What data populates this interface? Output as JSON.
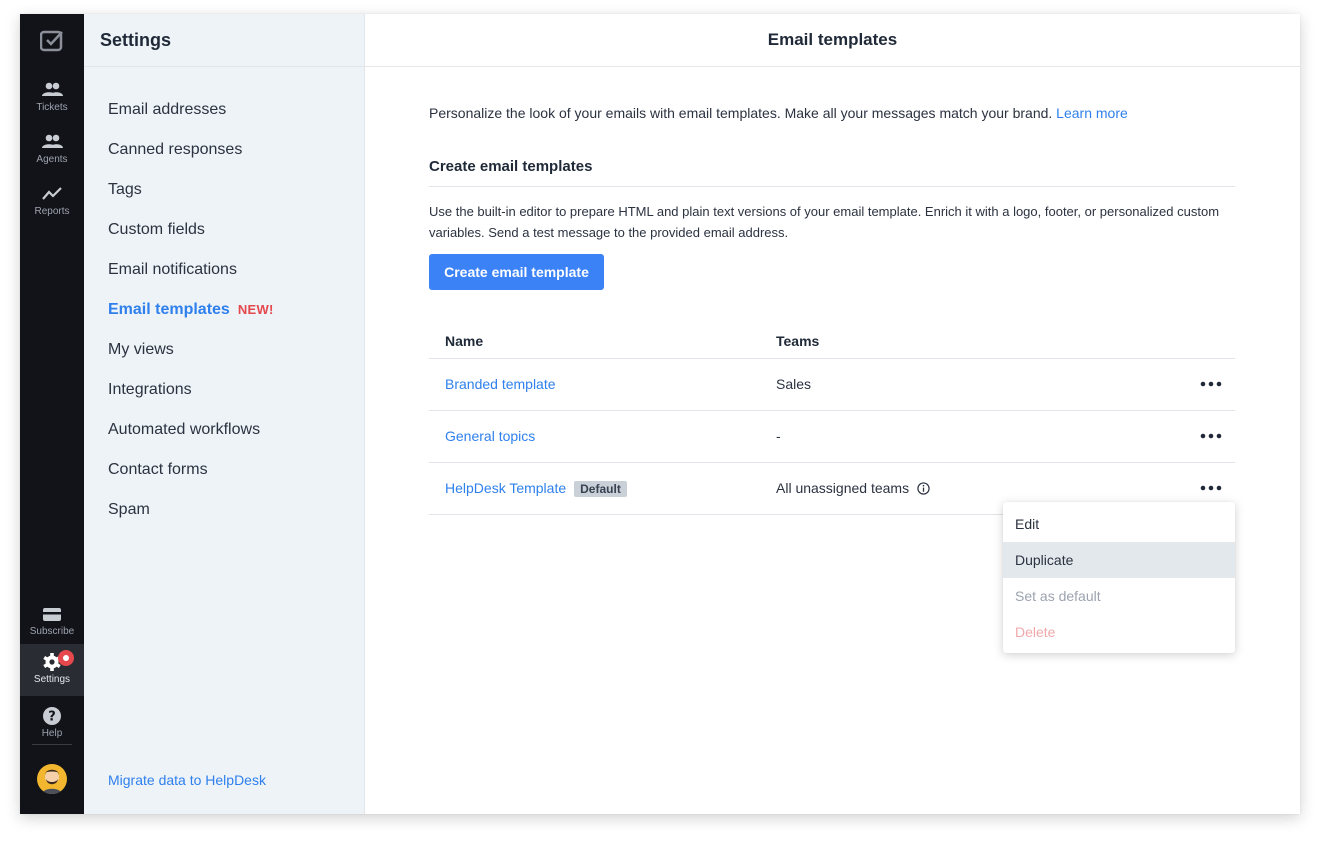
{
  "rail": {
    "items": [
      {
        "label": "Tickets",
        "icon": "people-icon"
      },
      {
        "label": "Agents",
        "icon": "people-icon"
      },
      {
        "label": "Reports",
        "icon": "chart-line-icon"
      }
    ],
    "bottom": [
      {
        "label": "Subscribe",
        "icon": "card-icon"
      },
      {
        "label": "Settings",
        "icon": "gear-icon"
      },
      {
        "label": "Help",
        "icon": "question-icon"
      }
    ]
  },
  "sidebar": {
    "title": "Settings",
    "items": [
      {
        "label": "Email addresses"
      },
      {
        "label": "Canned responses"
      },
      {
        "label": "Tags"
      },
      {
        "label": "Custom fields"
      },
      {
        "label": "Email notifications"
      },
      {
        "label": "Email templates",
        "tag": "NEW!"
      },
      {
        "label": "My views"
      },
      {
        "label": "Integrations"
      },
      {
        "label": "Automated workflows"
      },
      {
        "label": "Contact forms"
      },
      {
        "label": "Spam"
      }
    ],
    "migrate_link": "Migrate data to HelpDesk"
  },
  "main": {
    "title": "Email templates",
    "intro": "Personalize the look of your emails with email templates. Make all your messages match your brand.",
    "learn_more": "Learn more",
    "section_title": "Create email templates",
    "section_desc": "Use the built-in editor to prepare HTML and plain text versions of your email template. Enrich it with a logo, footer, or personalized custom variables. Send a test message to the provided email address.",
    "create_button": "Create email template",
    "table": {
      "headers": [
        "Name",
        "Teams"
      ],
      "rows": [
        {
          "name": "Branded template",
          "team": "Sales",
          "badge": ""
        },
        {
          "name": "General topics",
          "team": "-",
          "badge": ""
        },
        {
          "name": "HelpDesk Template",
          "team": "All unassigned teams",
          "badge": "Default"
        }
      ]
    },
    "menu": [
      "Edit",
      "Duplicate",
      "Set as default",
      "Delete"
    ]
  },
  "colors": {
    "accent": "#3b82f6",
    "link": "#2f80ed",
    "danger": "#e5484d",
    "rail": "#121318"
  }
}
